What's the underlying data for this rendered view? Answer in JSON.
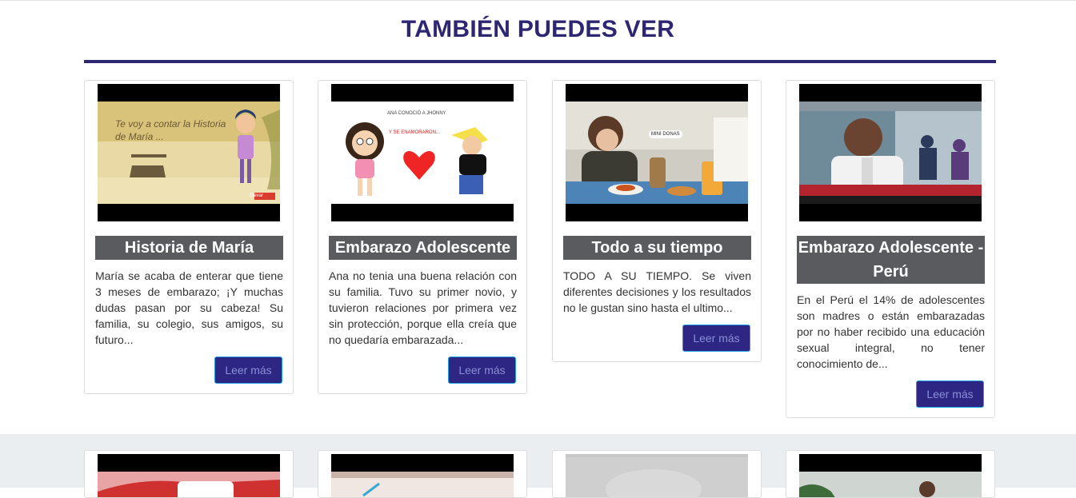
{
  "section": {
    "title": "TAMBIÉN PUEDES VER"
  },
  "cards": [
    {
      "title": "Historia de María",
      "text": "María se acaba de enterar que tiene 3 meses de embarazo; ¡Y muchas dudas pasan por su cabeza! Su familia, su colegio, sus amigos, su futuro...",
      "button": "Leer más",
      "thumb_overlay": "Te voy a contar la Historia de María ...",
      "thumb_logo": "Elevar"
    },
    {
      "title": "Embarazo Adolescente",
      "text": "Ana no tenia una buena relación con su familia. Tuvo su primer novio, y tuvieron relaciones por primera vez sin protección, porque ella creía que no quedaría embarazada...",
      "button": "Leer más",
      "thumb_overlay": "ANA CONOCIÓ A JHONNY",
      "thumb_overlay2": "Y SE ENAMORARON..."
    },
    {
      "title": "Todo a su tiempo",
      "text": "TODO A SU TIEMPO. Se viven diferentes decisiones y los resultados no le gustan sino hasta el ultimo...",
      "button": "Leer más",
      "thumb_overlay": "MINI DONAS"
    },
    {
      "title": "Embarazo Adolescente - Perú",
      "text": "En el Perú el 14% de adolescentes son madres o están embarazadas por no haber recibido una educación sexual integral, no tener conocimiento de...",
      "button": "Leer más"
    }
  ],
  "colors": {
    "accent": "#2d2672",
    "title_bg": "#5a5b5f",
    "button_bg": "#2d2682",
    "band": "#ebeef0"
  }
}
